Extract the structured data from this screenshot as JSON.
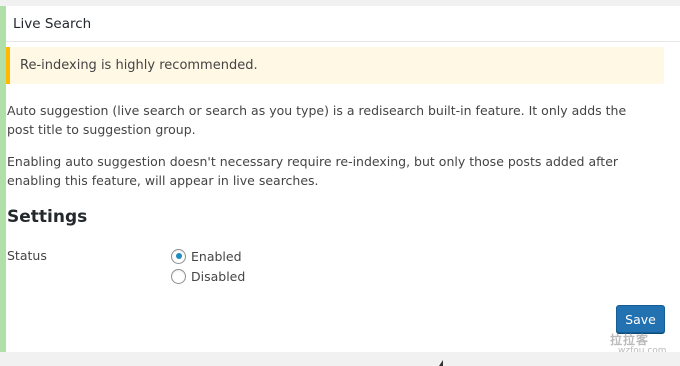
{
  "panel": {
    "title": "Live Search"
  },
  "notice": {
    "text": "Re-indexing is highly recommended."
  },
  "content": {
    "paragraph1": "Auto suggestion (live search or search as you type) is a redisearch built-in feature. It only adds the post title to suggestion group.",
    "paragraph2": "Enabling auto suggestion doesn't necessary require re-indexing, but only those posts added after enabling this feature, will appear in live searches."
  },
  "settings": {
    "heading": "Settings",
    "status_label": "Status",
    "options": [
      {
        "label": "Enabled",
        "checked": true
      },
      {
        "label": "Disabled",
        "checked": false
      }
    ]
  },
  "actions": {
    "save_label": "Save"
  },
  "watermark": {
    "line1": "拉拉客",
    "line2": "wzfou.com"
  },
  "colors": {
    "accent_border": "#b0e0a8",
    "notice_bg": "#fff8e5",
    "notice_border": "#ffb900",
    "button": "#2271b1"
  }
}
